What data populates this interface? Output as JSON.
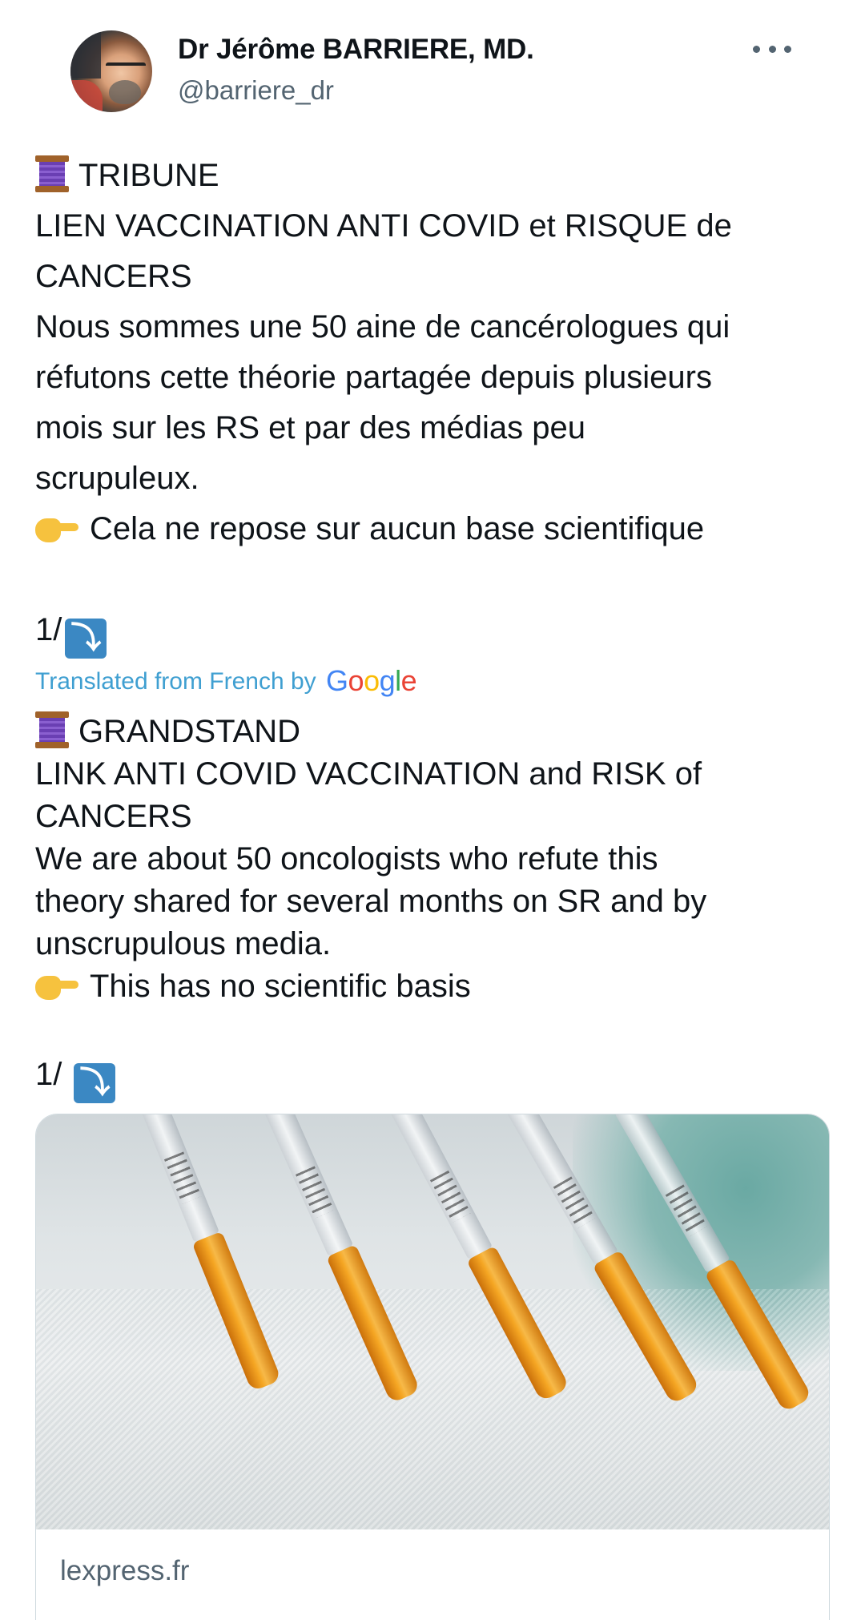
{
  "author": {
    "display_name": "Dr Jérôme BARRIERE, MD.",
    "handle": "@barriere_dr",
    "avatar_icon": "profile-photo"
  },
  "more_icon": "more-horizontal-icon",
  "original_text": {
    "line1": "TRIBUNE",
    "line2": "LIEN VACCINATION ANTI COVID et RISQUE de",
    "line3": "CANCERS",
    "line4": "Nous sommes une 50 aine de cancérologues qui",
    "line5": "réfutons cette théorie partagée depuis plusieurs",
    "line6": "mois sur les RS et par des médias peu",
    "line7": "scrupuleux.",
    "line8": "Cela ne repose sur aucun base scientifique",
    "thread_marker": "1/"
  },
  "translation_label": "Translated from French by",
  "translation_provider": "Google",
  "translated_text": {
    "line1": "GRANDSTAND",
    "line2": "LINK ANTI COVID VACCINATION and RISK of",
    "line3": "CANCERS",
    "line4": "We are about 50 oncologists who refute this",
    "line5": "theory shared for several months on SR and by",
    "line6": "unscrupulous media.",
    "line7": "This has no scientific basis",
    "thread_marker": "1/"
  },
  "emojis": {
    "spool": "spool-of-thread-emoji",
    "pointing": "backhand-index-pointing-right-emoji",
    "arrow": "right-arrow-curving-down-emoji",
    "arrow_glyph": "⤵"
  },
  "link_card": {
    "image_description_icon": "syringes-image",
    "domain": "lexpress.fr"
  }
}
